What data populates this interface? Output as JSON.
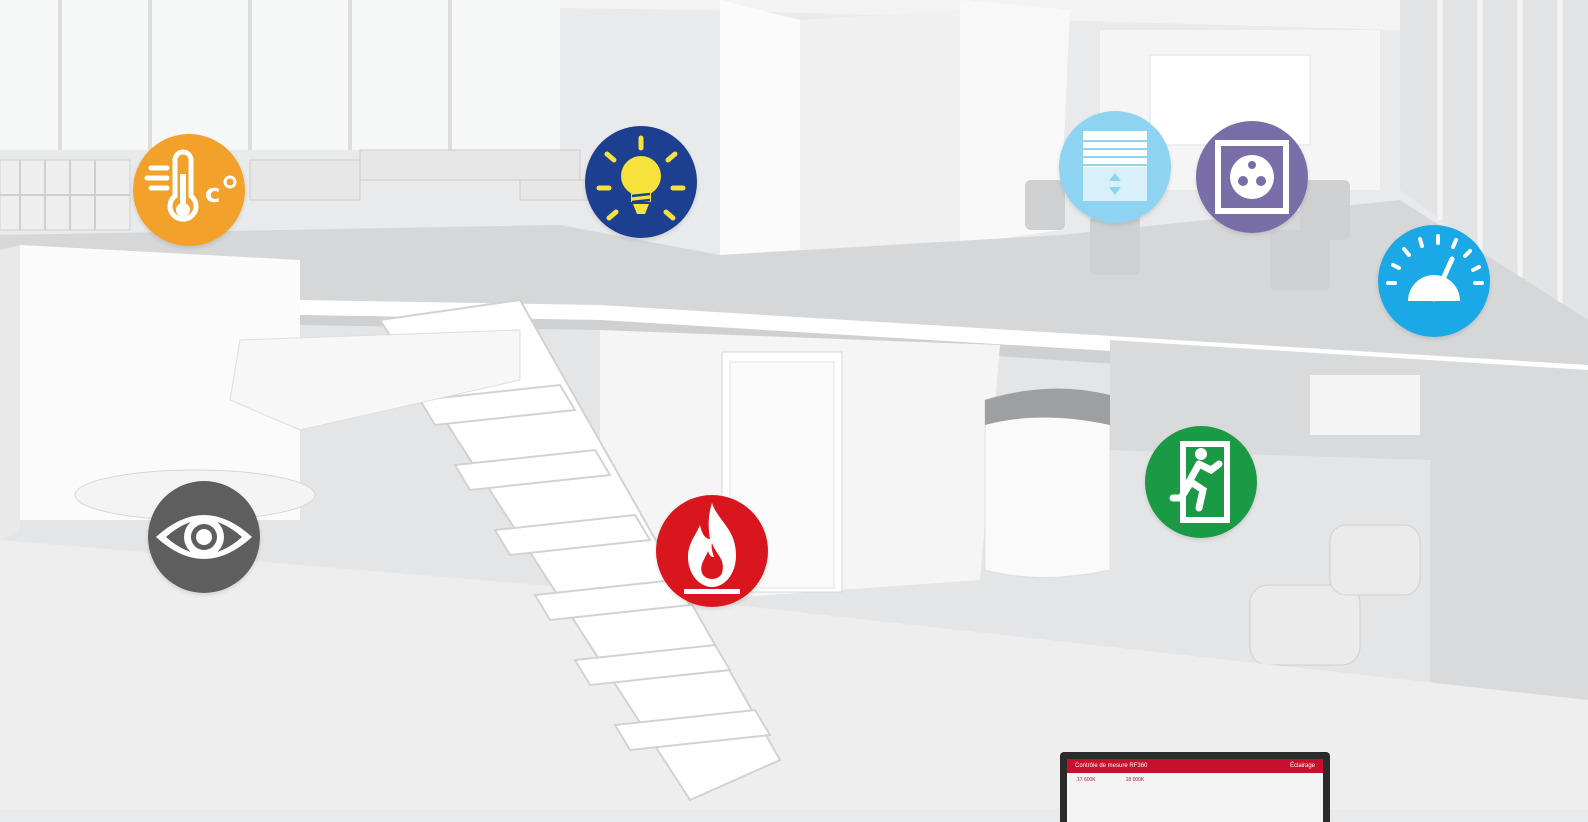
{
  "scene": {
    "description_icons": [
      {
        "name": "temperature-icon",
        "color": "#f2a12a"
      },
      {
        "name": "lighting-icon",
        "color": "#1d3f8f"
      },
      {
        "name": "blinds-icon",
        "color": "#8fd3f2"
      },
      {
        "name": "socket-icon",
        "color": "#7a6ea8"
      },
      {
        "name": "energy-meter-icon",
        "color": "#1aa9e6"
      },
      {
        "name": "presence-eye-icon",
        "color": "#5e5e5e"
      },
      {
        "name": "fire-alarm-icon",
        "color": "#d9161d"
      },
      {
        "name": "emergency-exit-icon",
        "color": "#1a9a45"
      }
    ]
  },
  "monitor": {
    "title": "Contrôle de mesure RF360",
    "tab": "Éclairage",
    "value_a": "17 600K",
    "value_b": "18 000K"
  }
}
